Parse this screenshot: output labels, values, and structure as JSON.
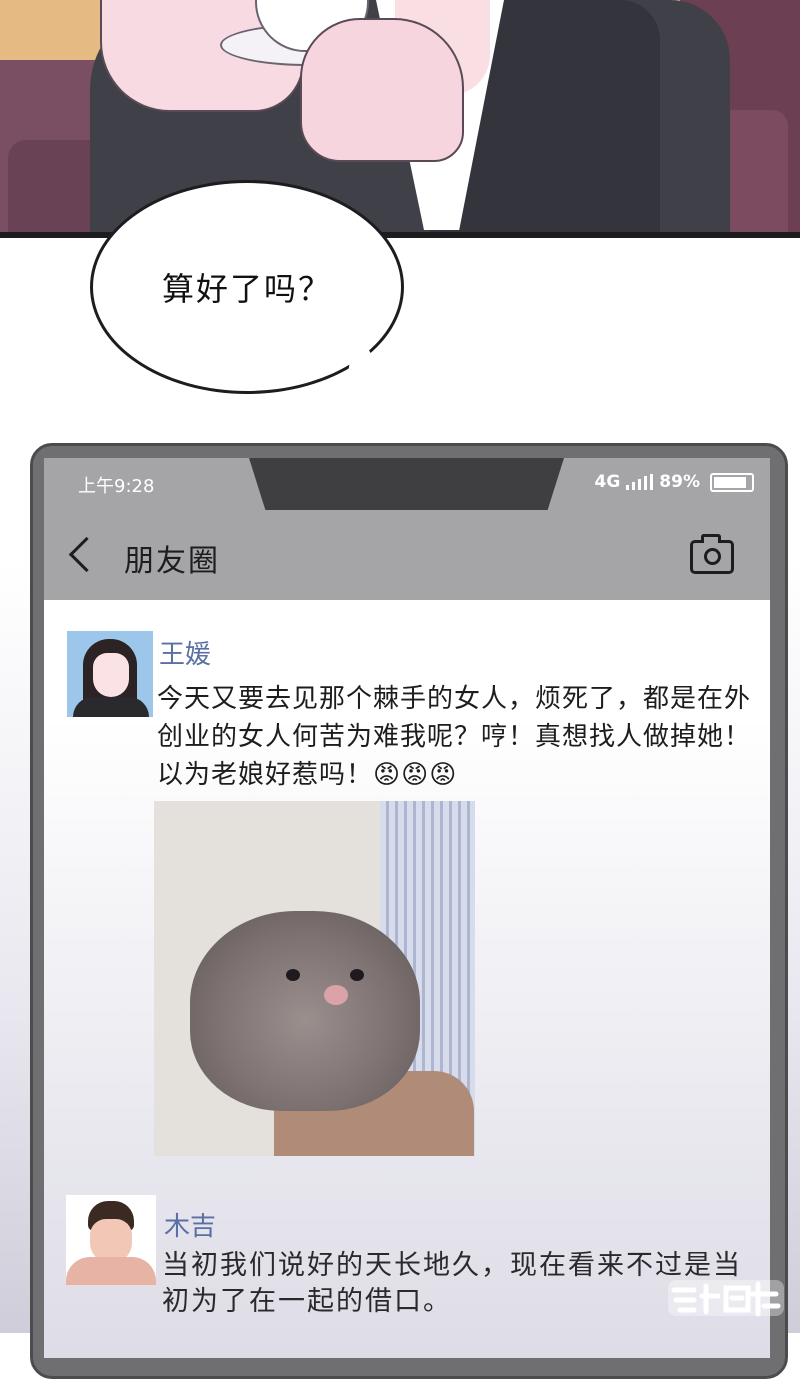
{
  "speech_bubble": {
    "text": "算好了吗？"
  },
  "status_bar": {
    "time": "上午9:28",
    "network": "4G",
    "battery": "89%"
  },
  "nav": {
    "title": "朋友圈",
    "back_icon": "chevron-left-icon",
    "camera_icon": "camera-icon"
  },
  "posts": [
    {
      "author": "王媛",
      "text": "今天又要去见那个棘手的女人，烦死了，都是在外创业的女人何苦为难我呢？哼！真想找人做掉她！以为老娘好惹吗！😡😡😡",
      "photo": "hamster-photo"
    },
    {
      "author": "木吉",
      "text": "当初我们说好的天长地久，现在看来不过是当初为了在一起的借口。"
    }
  ],
  "watermark": {
    "text": "漫客栈"
  },
  "colors": {
    "panel_background": "#e6bb83",
    "phone_frame": "#6f6f72",
    "status_bar": "#a5a5a8",
    "author_name": "#5a6fa3"
  }
}
